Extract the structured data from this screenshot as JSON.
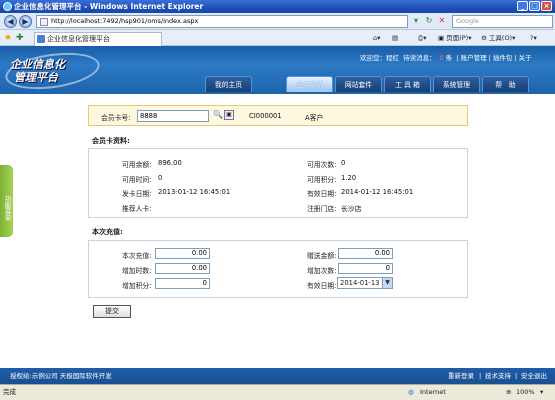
{
  "window": {
    "title": "企业信息化管理平台 - Windows Internet Explorer"
  },
  "browser": {
    "address": "http://localhost:7492/hsp901/oms/index.aspx",
    "search_placeholder": "Google",
    "tab_title": "企业信息化管理平台",
    "page_label": "页面(P)",
    "tools_label": "工具(O)",
    "status_text": "完成",
    "zone": "Internet",
    "zoom": "100%"
  },
  "header": {
    "logo_line1": "企业信息化",
    "logo_line2": "管理平台",
    "welcome": "欢迎您：程红",
    "messages_label": "待读消息：",
    "messages_count": "0",
    "messages_unit": "条",
    "account": "账户管理",
    "plugins": "插件包",
    "about": "关于",
    "menu": [
      "我的主页",
      "业务系统",
      "网站套件",
      "工 具 箱",
      "系统管理",
      "帮　助"
    ],
    "active_menu_index": 1
  },
  "side_tab": "功能菜单",
  "card_search": {
    "label": "会员卡号:",
    "value": "8888",
    "card_id": "CI000001",
    "customer": "A客户"
  },
  "card_info": {
    "title": "会员卡资料:",
    "balance_label": "可用余额:",
    "balance": "896.00",
    "times_label": "可用次数:",
    "times": "0",
    "time_label": "可用时间:",
    "time": "0",
    "points_label": "可用积分:",
    "points": "1.20",
    "issue_label": "发卡日期:",
    "issue_date": "2013-01-12 16:45:01",
    "valid_label": "有效日期:",
    "valid_date": "2014-01-12 16:45:01",
    "referrer_label": "推荐人卡:",
    "referrer": "",
    "store_label": "注册门店:",
    "store": "长沙店"
  },
  "recharge": {
    "title": "本次充值:",
    "amount_label": "本次充值:",
    "amount": "0.00",
    "bonus_label": "赠送金额:",
    "bonus": "0.00",
    "addtime_label": "增加时数:",
    "addtime": "0.00",
    "addcount_label": "增加次数:",
    "addcount": "0",
    "addpoints_label": "增加积分:",
    "addpoints": "0",
    "valid_label": "有效日期:",
    "valid": "2014-01-13"
  },
  "submit_label": "提交",
  "footer": {
    "left": "授权给:示例公司  天极国际软件开发",
    "relogin": "重新登录",
    "support": "技术支持",
    "logout": "安全退出"
  }
}
